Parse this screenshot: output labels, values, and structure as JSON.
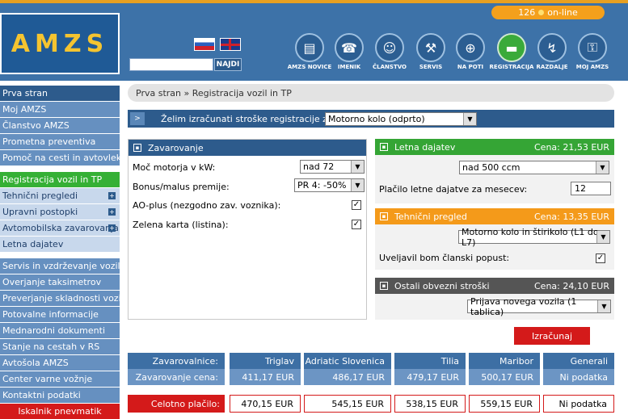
{
  "header": {
    "logo": "AMZS",
    "online_count": "126",
    "online_label": "on-line",
    "search_button": "NAJDI",
    "nav": [
      {
        "label": "AMZS NOVICE",
        "icon": "news-icon"
      },
      {
        "label": "IMENIK",
        "icon": "phonebook-icon"
      },
      {
        "label": "ČLANSTVO",
        "icon": "members-icon"
      },
      {
        "label": "SERVIS",
        "icon": "service-icon"
      },
      {
        "label": "NA POTI",
        "icon": "globe-icon"
      },
      {
        "label": "REGISTRACIJA",
        "icon": "car-icon"
      },
      {
        "label": "RAZDALJE",
        "icon": "route-icon"
      },
      {
        "label": "MOJ AMZS",
        "icon": "lock-icon"
      }
    ]
  },
  "sidebar": {
    "group1": [
      "Prva stran",
      "Moj AMZS",
      "Članstvo AMZS",
      "Prometna preventiva",
      "Pomoč na cesti in avtovleka"
    ],
    "group2": [
      "Registracija vozil in TP",
      "Tehnični pregledi",
      "Upravni postopki",
      "Avtomobilska zavarovanja",
      "Letna dajatev"
    ],
    "group3": [
      "Servis in vzdrževanje vozil",
      "Overjanje taksimetrov",
      "Preverjanje skladnosti vozil",
      "Potovalne informacije",
      "Mednarodni dokumenti",
      "Stanje na cestah v RS",
      "Avtošola AMZS",
      "Center varne vožnje",
      "Kontaktni podatki"
    ],
    "red_item": "Iskalnik pnevmatik"
  },
  "breadcrumb": "Prva stran » Registracija vozil in TP",
  "question": {
    "label": "Želim izračunati stroške registracije za",
    "value": "Motorno kolo (odprto)"
  },
  "zavarovanje": {
    "title": "Zavarovanje",
    "power_label": "Moč motorja v kW:",
    "power_value": "nad 72",
    "bonus_label": "Bonus/malus premije:",
    "bonus_value": "PR 4: -50%",
    "ao_label": "AO-plus (nezgodno zav. voznika):",
    "green_label": "Zelena karta (listina):"
  },
  "letna": {
    "title": "Letna dajatev",
    "cost": "Cena: 21,53 EUR",
    "select": "nad 500 ccm",
    "months_label": "Plačilo letne dajatve za mesecev:",
    "months_value": "12"
  },
  "tehnicni": {
    "title": "Tehnični pregled",
    "cost": "Cena: 13,35 EUR",
    "select": "Motorno kolo in štirikolo (L1 do L7)",
    "discount_label": "Uveljavil bom članski popust:"
  },
  "ostali": {
    "title": "Ostali obvezni stroški",
    "cost": "Cena: 24,10 EUR",
    "select": "Prijava novega vozila (1 tablica)"
  },
  "calc_button": "Izračunaj",
  "results": {
    "header_label": "Zavarovalnice:",
    "price_label": "Zavarovanje cena:",
    "total_label": "Celotno plačilo:",
    "insurers": [
      {
        "name": "Triglav",
        "price": "411,17 EUR",
        "total": "470,15 EUR"
      },
      {
        "name": "Adriatic Slovenica",
        "price": "486,17 EUR",
        "total": "545,15 EUR"
      },
      {
        "name": "Tilia",
        "price": "479,17 EUR",
        "total": "538,15 EUR"
      },
      {
        "name": "Maribor",
        "price": "500,17 EUR",
        "total": "559,15 EUR"
      },
      {
        "name": "Generali",
        "price": "Ni podatka",
        "total": "Ni podatka"
      }
    ]
  }
}
